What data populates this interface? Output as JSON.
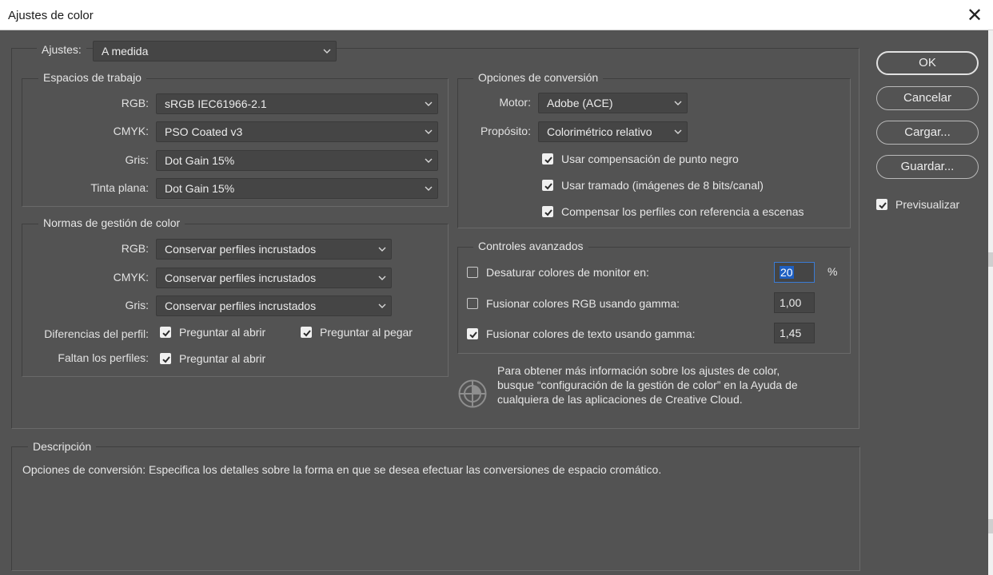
{
  "window": {
    "title": "Ajustes de color",
    "close_glyph": "✕"
  },
  "settings": {
    "label": "Ajustes:",
    "value": "A medida"
  },
  "working_spaces": {
    "legend": "Espacios de trabajo",
    "rgb": {
      "label": "RGB:",
      "value": "sRGB IEC61966-2.1"
    },
    "cmyk": {
      "label": "CMYK:",
      "value": "PSO Coated v3"
    },
    "gray": {
      "label": "Gris:",
      "value": "Dot Gain 15%"
    },
    "spot": {
      "label": "Tinta plana:",
      "value": "Dot Gain 15%"
    }
  },
  "policies": {
    "legend": "Normas de gestión de color",
    "rgb": {
      "label": "RGB:",
      "value": "Conservar perfiles incrustados"
    },
    "cmyk": {
      "label": "CMYK:",
      "value": "Conservar perfiles incrustados"
    },
    "gray": {
      "label": "Gris:",
      "value": "Conservar perfiles incrustados"
    },
    "mismatch": {
      "label": "Diferencias del perfil:",
      "ask_open": "Preguntar al abrir",
      "ask_paste": "Preguntar al pegar",
      "ask_open_checked": true,
      "ask_paste_checked": true
    },
    "missing": {
      "label": "Faltan los perfiles:",
      "ask_open": "Preguntar al abrir",
      "ask_open_checked": true
    }
  },
  "conversion": {
    "legend": "Opciones de conversión",
    "engine": {
      "label": "Motor:",
      "value": "Adobe (ACE)"
    },
    "intent": {
      "label": "Propósito:",
      "value": "Colorimétrico relativo"
    },
    "options": [
      {
        "label": "Usar compensación de punto negro",
        "checked": true
      },
      {
        "label": "Usar tramado (imágenes de 8 bits/canal)",
        "checked": true
      },
      {
        "label": "Compensar los perfiles con referencia a escenas",
        "checked": true
      }
    ]
  },
  "advanced": {
    "legend": "Controles avanzados",
    "desaturate": {
      "label": "Desaturar colores de monitor en:",
      "checked": false,
      "value": "20",
      "unit": "%"
    },
    "blend_rgb": {
      "label": "Fusionar colores RGB usando gamma:",
      "checked": false,
      "value": "1,00"
    },
    "blend_text": {
      "label": "Fusionar colores de texto usando gamma:",
      "checked": true,
      "value": "1,45"
    }
  },
  "info": {
    "line1": "Para obtener más información sobre los ajustes de color,",
    "line2": "busque “configuración de la gestión de color” en la Ayuda de",
    "line3": "cualquiera de las aplicaciones de Creative Cloud."
  },
  "buttons": {
    "ok": "OK",
    "cancel": "Cancelar",
    "load": "Cargar...",
    "save": "Guardar..."
  },
  "preview": {
    "label": "Previsualizar",
    "checked": true
  },
  "description": {
    "legend": "Descripción",
    "text": "Opciones de conversión: Especifica los detalles sobre la forma en que se desea efectuar las conversiones de espacio cromático."
  },
  "colors": {
    "dialog_bg": "#535353",
    "field_bg": "#454545",
    "focus": "#3b7bd4",
    "selection": "#1e5fc2"
  }
}
